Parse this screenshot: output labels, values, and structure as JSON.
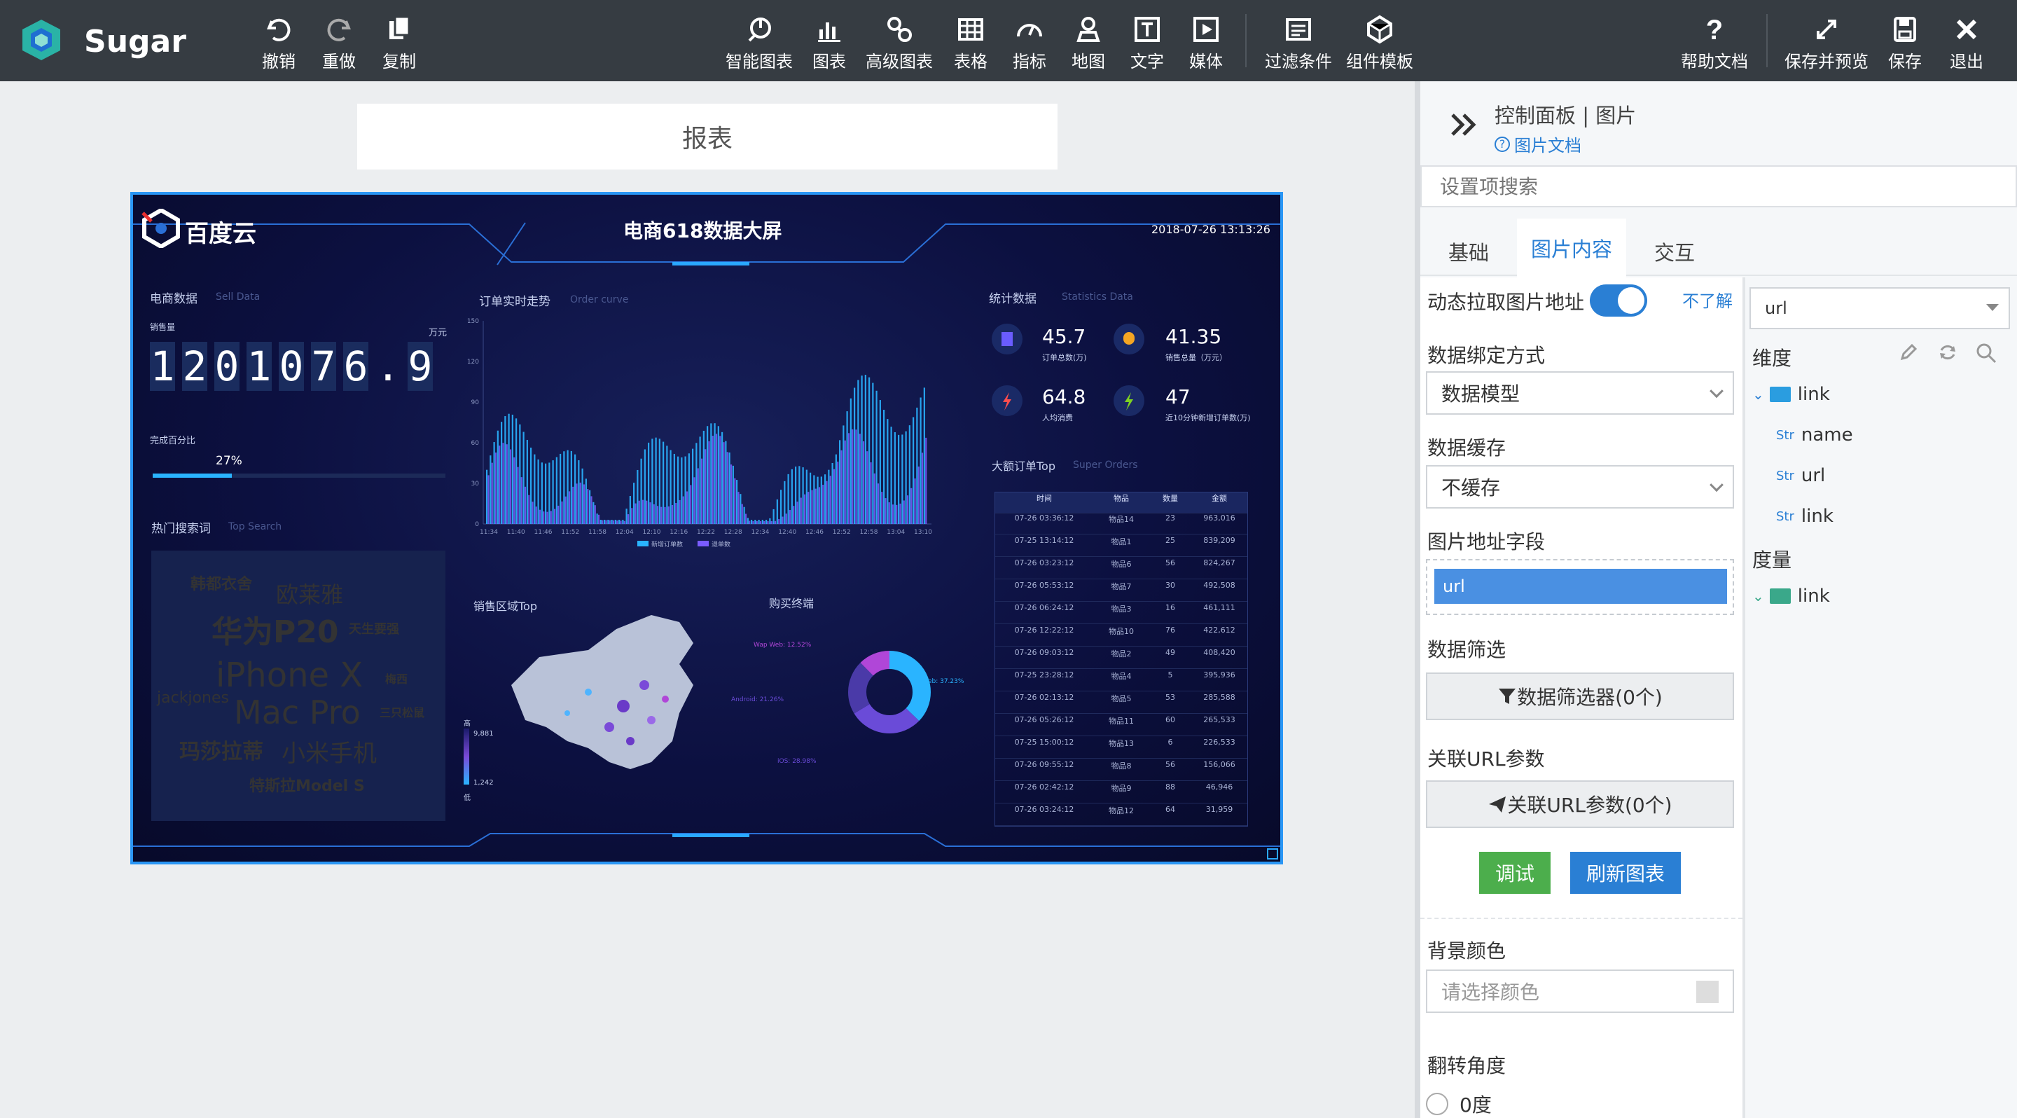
{
  "app": {
    "name": "Sugar"
  },
  "toolbar": {
    "left": [
      {
        "label": "撤销",
        "icon": "undo-icon"
      },
      {
        "label": "重做",
        "icon": "redo-icon"
      },
      {
        "label": "复制",
        "icon": "copy-icon"
      }
    ],
    "center": [
      {
        "label": "智能图表",
        "icon": "smart-chart-icon"
      },
      {
        "label": "图表",
        "icon": "bar-chart-icon"
      },
      {
        "label": "高级图表",
        "icon": "advanced-chart-icon"
      },
      {
        "label": "表格",
        "icon": "table-icon"
      },
      {
        "label": "指标",
        "icon": "gauge-icon"
      },
      {
        "label": "地图",
        "icon": "map-pin-icon"
      },
      {
        "label": "文字",
        "icon": "text-icon"
      },
      {
        "label": "媒体",
        "icon": "media-icon"
      },
      {
        "label": "过滤条件",
        "icon": "filter-condition-icon"
      },
      {
        "label": "组件模板",
        "icon": "component-template-icon"
      }
    ],
    "right": [
      {
        "label": "帮助文档",
        "icon": "help-icon"
      },
      {
        "label": "保存并预览",
        "icon": "expand-icon"
      },
      {
        "label": "保存",
        "icon": "save-icon"
      },
      {
        "label": "退出",
        "icon": "close-icon"
      }
    ]
  },
  "canvas": {
    "report_title": "报表"
  },
  "panel": {
    "header": "控制面板 | 图片",
    "doc_link": "图片文档",
    "search_placeholder": "设置项搜索",
    "tabs": [
      "基础",
      "图片内容",
      "交互"
    ],
    "active_tab": "图片内容",
    "dynamic_fetch": {
      "label": "动态拉取图片地址",
      "enabled": true,
      "help": "不了解"
    },
    "bind_mode": {
      "label": "数据绑定方式",
      "value": "数据模型"
    },
    "cache": {
      "label": "数据缓存",
      "value": "不缓存"
    },
    "url_field": {
      "label": "图片地址字段",
      "value": "url"
    },
    "filter": {
      "label": "数据筛选",
      "button": "数据筛选器(0个)"
    },
    "url_params": {
      "label": "关联URL参数",
      "button": "关联URL参数(0个)"
    },
    "debug_button": "调试",
    "refresh_button": "刷新图表",
    "bg_color": {
      "label": "背景颜色",
      "placeholder": "请选择颜色"
    },
    "rotate": {
      "label": "翻转角度",
      "option": "0度"
    },
    "model_select": "url",
    "dimensions_label": "维度",
    "dimension_folder": "link",
    "dimension_fields": [
      {
        "type": "Str",
        "name": "name"
      },
      {
        "type": "Str",
        "name": "url"
      },
      {
        "type": "Str",
        "name": "link"
      }
    ],
    "measures_label": "度量",
    "measure_folder": "link"
  },
  "dashboard": {
    "title": "电商618数据大屏",
    "timestamp": "2018-07-26 13:13:26",
    "brand": "百度云",
    "sell": {
      "title": "电商数据",
      "title_en": "Sell Data",
      "sub": "销售量",
      "unit": "万元",
      "digits": [
        "1",
        "2",
        "0",
        "1",
        "0",
        "7",
        "6",
        ".",
        "9"
      ],
      "pct_label": "完成百分比",
      "pct": "27%",
      "pct_value": 0.27
    },
    "hot": {
      "title": "热门搜索词",
      "title_en": "Top Search",
      "words": [
        {
          "t": "韩都衣舍",
          "c": "#b046d8"
        },
        {
          "t": "欧莱雅",
          "c": "#6a4bd8"
        },
        {
          "t": "华为P20",
          "c": "#5a7bff"
        },
        {
          "t": "天生要强",
          "c": "#4fb4ff"
        },
        {
          "t": "iPhone X",
          "c": "#4fb4ff"
        },
        {
          "t": "梅西",
          "c": "#b046d8"
        },
        {
          "t": "jackjones",
          "c": "#4fb4ff"
        },
        {
          "t": "Mac Pro",
          "c": "#5a7bff"
        },
        {
          "t": "三只松鼠",
          "c": "#4fb4ff"
        },
        {
          "t": "玛莎拉蒂",
          "c": "#5a7bff"
        },
        {
          "t": "小米手机",
          "c": "#b046d8"
        },
        {
          "t": "特斯拉Model S",
          "c": "#6a4bd8"
        }
      ]
    },
    "order_curve": {
      "title": "订单实时走势",
      "title_en": "Order curve",
      "y_ticks": [
        "150",
        "120",
        "90",
        "60",
        "30",
        "0"
      ],
      "x_ticks": [
        "11:34",
        "11:40",
        "11:46",
        "11:52",
        "11:58",
        "12:04",
        "12:10",
        "12:16",
        "12:22",
        "12:28",
        "12:34",
        "12:40",
        "12:46",
        "12:52",
        "12:58",
        "13:04",
        "13:10"
      ],
      "legend": [
        "新增订单数",
        "退单数"
      ]
    },
    "region": {
      "title": "销售区域Top",
      "high": "高",
      "low": "低",
      "max": "9,881",
      "min": "1,242"
    },
    "terminal": {
      "title": "购买终端",
      "labels": [
        "Wap Web: 12.52%",
        "Android: 21.26%",
        "iOS: 28.98%",
        "PC Web: 37.23%"
      ]
    },
    "stats": {
      "title": "统计数据",
      "title_en": "Statistics Data",
      "items": [
        {
          "value": "45.7",
          "label": "订单总数(万)",
          "icon": "clipboard-icon",
          "color": "#6a5cff"
        },
        {
          "value": "41.35",
          "label": "销售总量（万元）",
          "icon": "bulb-icon",
          "color": "#f5a623"
        },
        {
          "value": "64.8",
          "label": "人均消费",
          "icon": "flash-icon",
          "color": "#ff4d4d"
        },
        {
          "value": "47",
          "label": "近10分钟新增订单数(万)",
          "icon": "bolt-icon",
          "color": "#7ed321"
        }
      ]
    },
    "orders": {
      "title": "大额订单Top",
      "title_en": "Super Orders",
      "headers": [
        "时间",
        "物品",
        "数量",
        "金额"
      ],
      "rows": [
        [
          "07-26 03:36:12",
          "物品14",
          "23",
          "963,016"
        ],
        [
          "07-25 13:14:12",
          "物品1",
          "25",
          "839,209"
        ],
        [
          "07-26 03:23:12",
          "物品6",
          "56",
          "824,267"
        ],
        [
          "07-26 05:53:12",
          "物品7",
          "30",
          "492,508"
        ],
        [
          "07-26 06:24:12",
          "物品3",
          "16",
          "461,111"
        ],
        [
          "07-26 12:22:12",
          "物品10",
          "76",
          "422,612"
        ],
        [
          "07-26 09:03:12",
          "物品2",
          "49",
          "408,420"
        ],
        [
          "07-25 23:28:12",
          "物品4",
          "5",
          "395,936"
        ],
        [
          "07-26 02:13:12",
          "物品5",
          "53",
          "285,588"
        ],
        [
          "07-26 05:26:12",
          "物品11",
          "60",
          "265,533"
        ],
        [
          "07-25 15:00:12",
          "物品13",
          "6",
          "226,533"
        ],
        [
          "07-26 09:55:12",
          "物品8",
          "56",
          "156,066"
        ],
        [
          "07-26 02:42:12",
          "物品9",
          "88",
          "46,946"
        ],
        [
          "07-26 03:24:12",
          "物品12",
          "64",
          "31,959"
        ]
      ]
    }
  }
}
